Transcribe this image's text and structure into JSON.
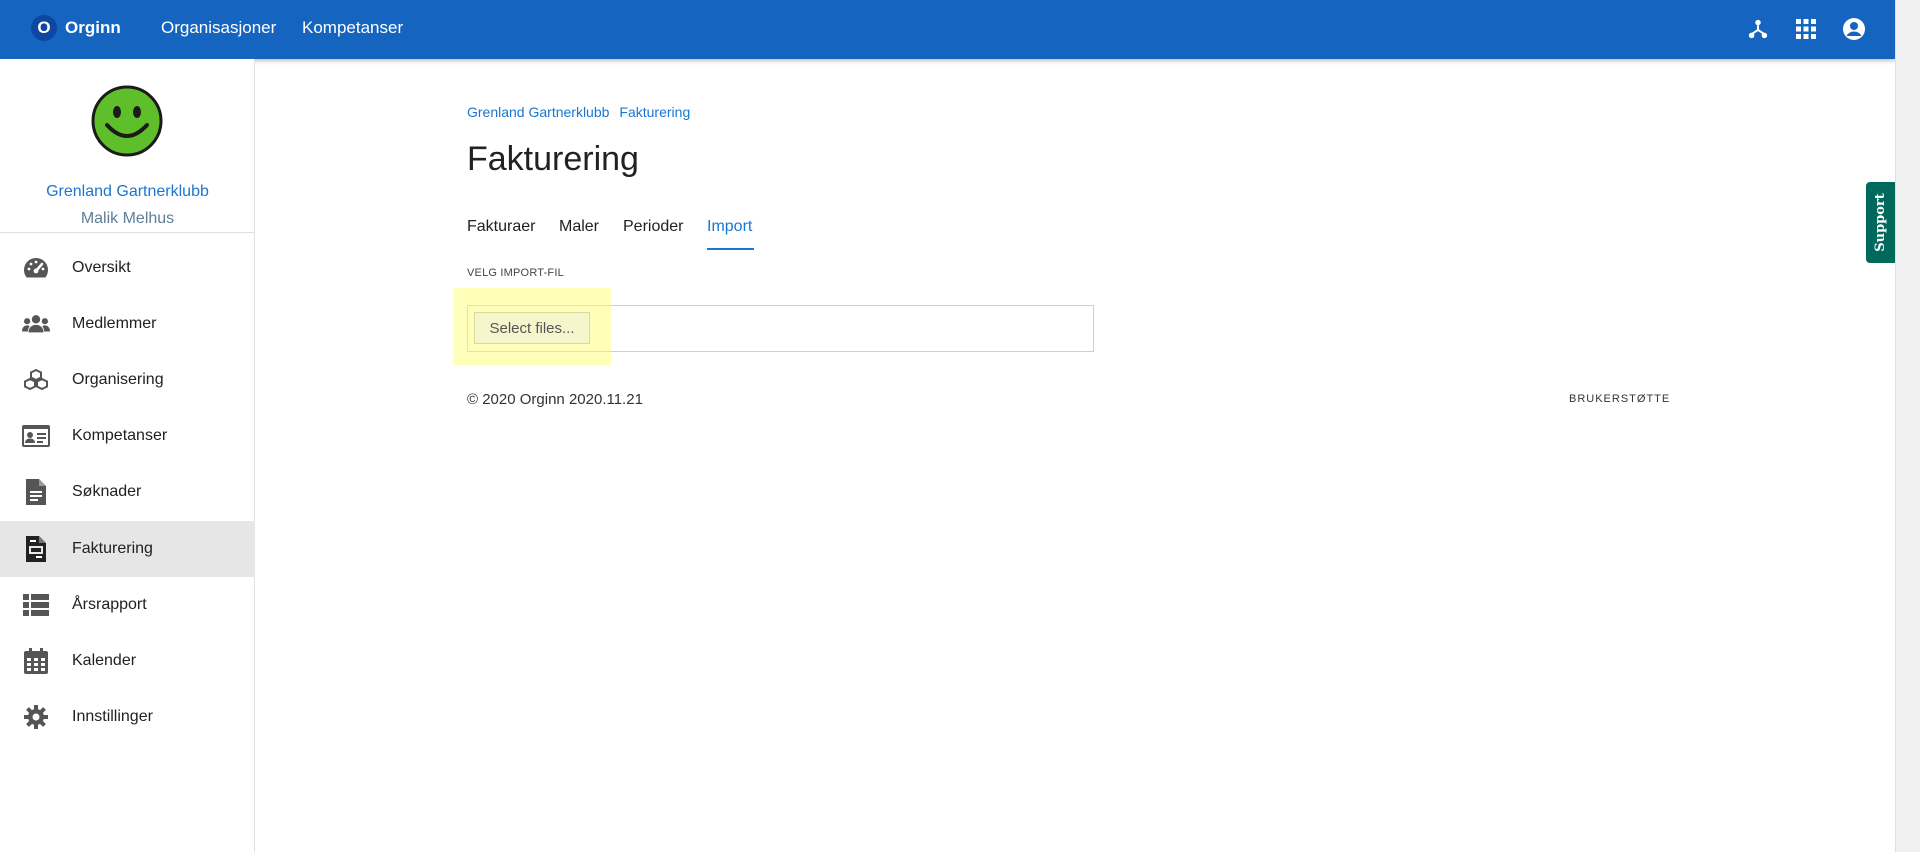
{
  "topbar": {
    "brand_initial": "O",
    "brand_name": "Orginn",
    "nav": [
      "Organisasjoner",
      "Kompetanser"
    ],
    "icons": [
      "hierarchy-icon",
      "apps-grid-icon",
      "account-circle-icon"
    ],
    "color": "#1565c0"
  },
  "sidebar": {
    "avatar": "smiley-face",
    "org_name": "Grenland Gartnerklubb",
    "user_name": "Malik Melhus",
    "items": [
      {
        "label": "Oversikt",
        "icon": "dashboard-gauge-icon"
      },
      {
        "label": "Medlemmer",
        "icon": "group-people-icon"
      },
      {
        "label": "Organisering",
        "icon": "cubes-icon"
      },
      {
        "label": "Kompetanser",
        "icon": "id-card-icon"
      },
      {
        "label": "Søknader",
        "icon": "document-icon"
      },
      {
        "label": "Fakturering",
        "icon": "invoice-icon",
        "active": true
      },
      {
        "label": "Årsrapport",
        "icon": "list-icon"
      },
      {
        "label": "Kalender",
        "icon": "calendar-icon"
      },
      {
        "label": "Innstillinger",
        "icon": "gear-icon"
      }
    ]
  },
  "main": {
    "breadcrumbs": [
      "Grenland Gartnerklubb",
      "Fakturering"
    ],
    "title": "Fakturering",
    "tabs": [
      {
        "label": "Fakturaer"
      },
      {
        "label": "Maler"
      },
      {
        "label": "Perioder"
      },
      {
        "label": "Import",
        "active": true
      }
    ],
    "import_label": "VELG IMPORT-FIL",
    "select_files_label": "Select files...",
    "footer_copyright": "© 2020 Orginn 2020.11.21",
    "footer_link": "BRUKERSTØTTE"
  },
  "support_tab": {
    "label": "Support",
    "color": "#00695c"
  }
}
